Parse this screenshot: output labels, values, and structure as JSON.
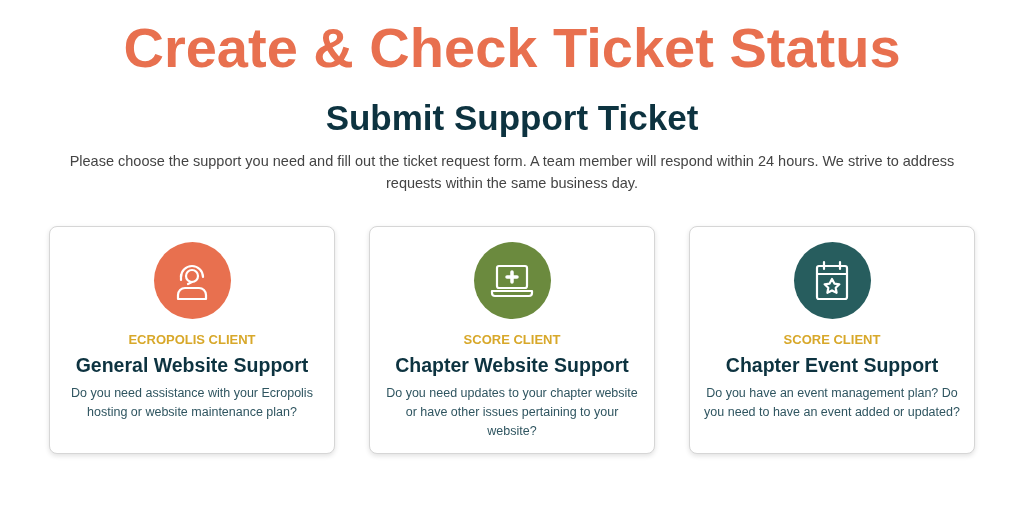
{
  "page_title": "Create & Check Ticket Status",
  "section": {
    "heading": "Submit Support Ticket",
    "intro": "Please choose the support you need and fill out the ticket request form. A team member will respond within 24 hours. We strive to address requests within the same business day."
  },
  "cards": [
    {
      "kind": "headset",
      "color": "#e8704f",
      "eyebrow": "ECROPOLIS CLIENT",
      "title": "General Website Support",
      "description": "Do you need assistance with your Ecropolis hosting or website maintenance plan?"
    },
    {
      "kind": "laptop",
      "color": "#6b8a3e",
      "eyebrow": "SCORE CLIENT",
      "title": "Chapter Website Support",
      "description": "Do you need updates to your chapter website or have other issues pertaining to your website?"
    },
    {
      "kind": "calendar",
      "color": "#275d5e",
      "eyebrow": "SCORE CLIENT",
      "title": "Chapter Event Support",
      "description": "Do you have an event management plan? Do you need to have an event added or updated?"
    }
  ]
}
